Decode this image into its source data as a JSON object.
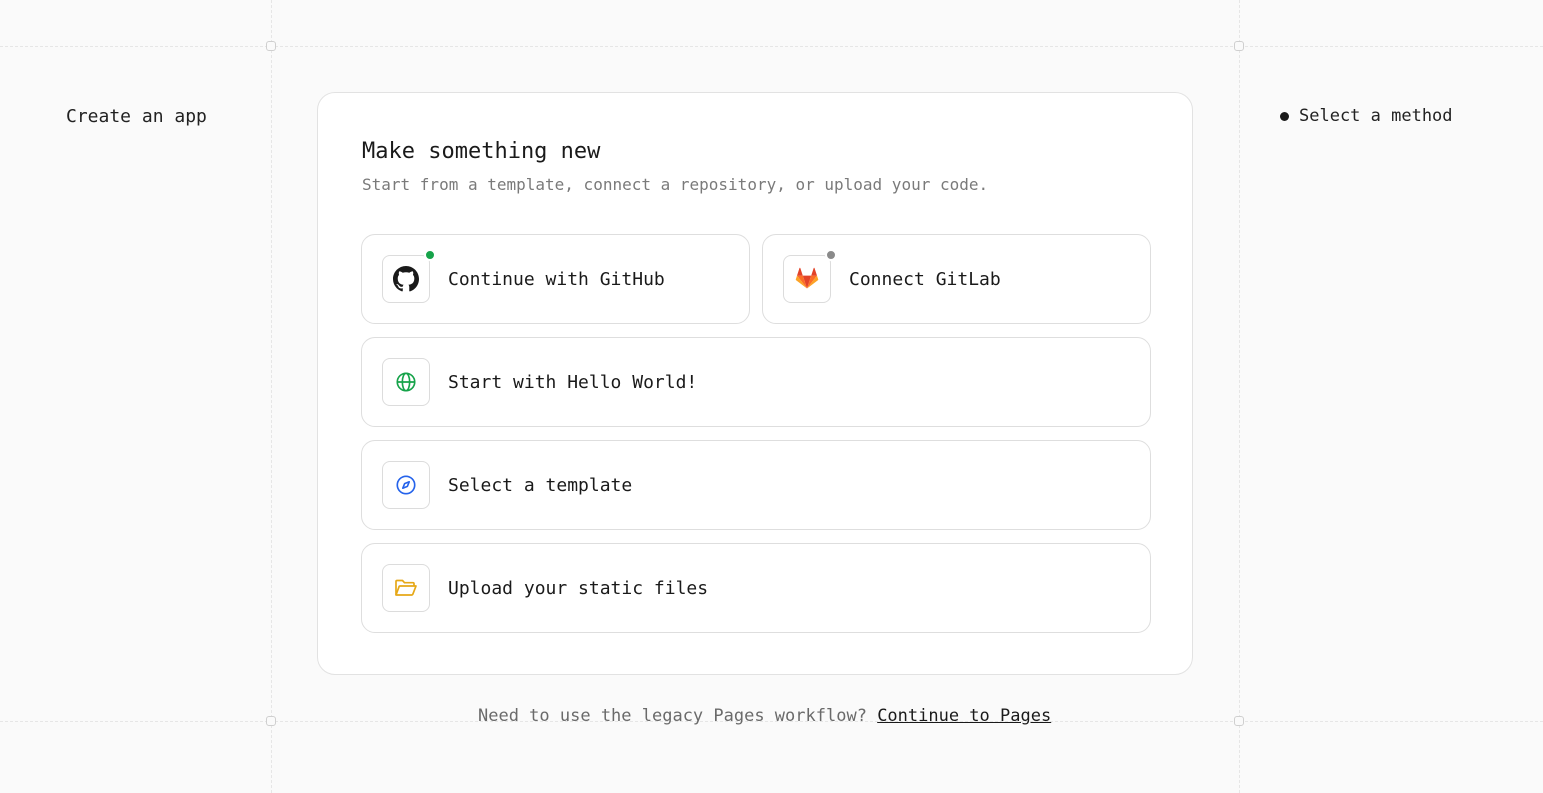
{
  "sidebar": {
    "title": "Create an app"
  },
  "steps": {
    "current": "Select a method"
  },
  "card": {
    "title": "Make something new",
    "subtitle": "Start from a template, connect a repository, or upload your code."
  },
  "options": {
    "github": {
      "label": "Continue with GitHub",
      "icon": "github-icon",
      "status_color": "#16a34a"
    },
    "gitlab": {
      "label": "Connect GitLab",
      "icon": "gitlab-icon",
      "status_color": "#8a8a8a"
    },
    "hello": {
      "label": "Start with Hello World!",
      "icon": "globe-icon"
    },
    "template": {
      "label": "Select a template",
      "icon": "compass-icon"
    },
    "upload": {
      "label": "Upload your static files",
      "icon": "folder-icon"
    }
  },
  "footer": {
    "text": "Need to use the legacy Pages workflow?",
    "link": "Continue to Pages"
  },
  "colors": {
    "background": "#fafafa",
    "card": "#ffffff",
    "github_status": "#16a34a",
    "gitlab_status": "#8a8a8a",
    "globe": "#16a34a",
    "compass": "#2563eb",
    "folder": "#e6a817"
  }
}
